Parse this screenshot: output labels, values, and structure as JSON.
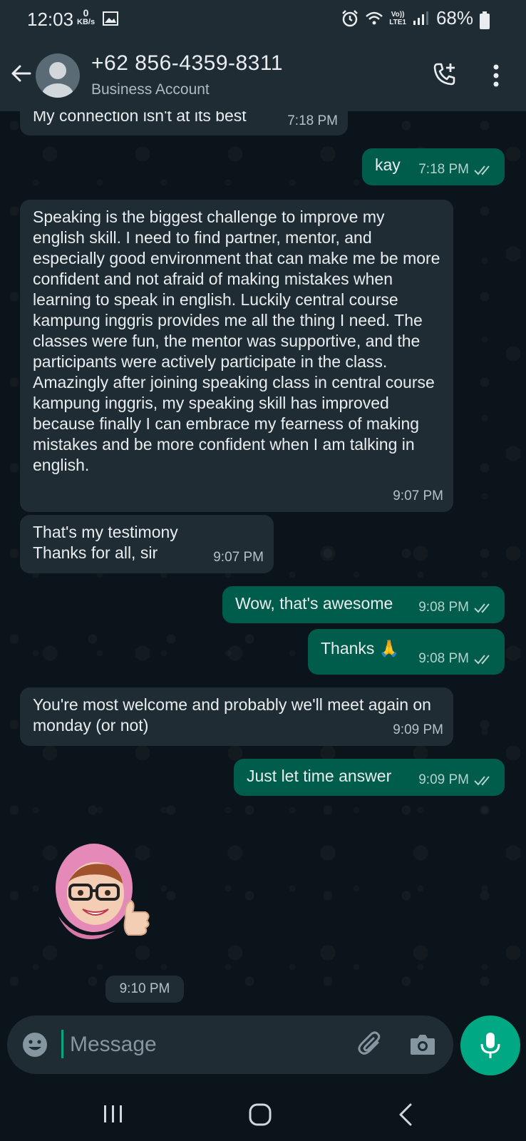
{
  "status_bar": {
    "time": "12:03",
    "net_speed_value": "0",
    "net_speed_unit": "KB/s",
    "lte_label_top": "Vo))",
    "lte_label_bottom": "LTE1",
    "battery": "68%"
  },
  "header": {
    "contact_name": "+62 856-4359-8311",
    "subtitle": "Business Account"
  },
  "messages": [
    {
      "dir": "in",
      "text": "My connection isn't at its best",
      "time": "7:18 PM"
    },
    {
      "dir": "out",
      "text": "kay",
      "time": "7:18 PM"
    },
    {
      "dir": "in",
      "text": "Speaking is the biggest challenge to improve my english skill. I need to find partner, mentor, and especially good environment that can make me be more confident and not afraid of making mistakes when learning to speak in english. Luckily central course kampung inggris provides me all the thing I need. The classes were fun, the mentor was supportive, and the participants were actively participate in the class. Amazingly after joining speaking class in central course kampung inggris, my speaking skill has improved because finally I can embrace my fearness of making mistakes and be more confident when I am talking in english.",
      "time": "9:07 PM"
    },
    {
      "dir": "in",
      "text_line1": "That's my testimony",
      "text_line2": "Thanks for all, sir",
      "time": "9:07 PM"
    },
    {
      "dir": "out",
      "text": "Wow, that's awesome",
      "time": "9:08 PM"
    },
    {
      "dir": "out",
      "text": "Thanks 🙏",
      "time": "9:08 PM"
    },
    {
      "dir": "in",
      "text": "You're most welcome and probably we'll meet again on monday (or not)",
      "time": "9:09 PM"
    },
    {
      "dir": "out",
      "text": "Just let time answer",
      "time": "9:09 PM"
    }
  ],
  "sticker": {
    "time": "9:10 PM"
  },
  "composer": {
    "placeholder": "Message"
  },
  "colors": {
    "background": "#0b141a",
    "incoming": "#1f2c34",
    "outgoing": "#005c4b",
    "accent": "#00a884",
    "read_ticks": "#b5d3cc"
  },
  "icons": [
    "back-arrow-icon",
    "add-call-icon",
    "more-options-icon",
    "emoji-icon",
    "attach-icon",
    "camera-icon",
    "mic-icon",
    "double-check-icon"
  ]
}
